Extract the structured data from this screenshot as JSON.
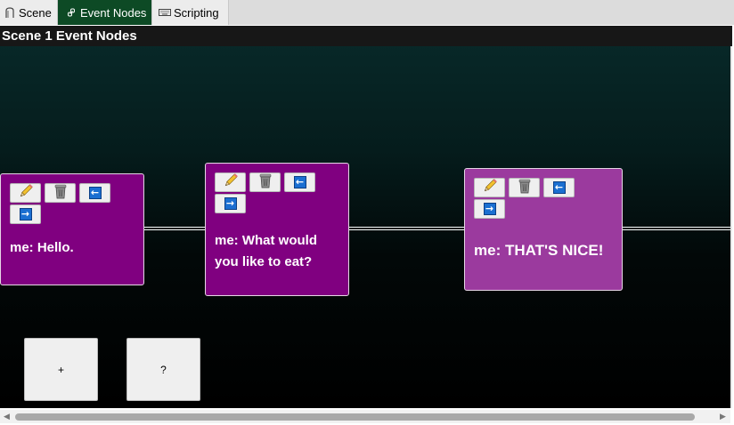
{
  "tabs": [
    {
      "label": "Scene",
      "icon": "scene-icon"
    },
    {
      "label": "Event Nodes",
      "icon": "link-icon"
    },
    {
      "label": "Scripting",
      "icon": "keyboard-icon"
    }
  ],
  "active_tab": "Event Nodes",
  "editor": {
    "title": "Scene 1 Event Nodes"
  },
  "nodes": [
    {
      "text": "me: Hello.",
      "buttons": [
        "pencil-icon",
        "trash-icon",
        "arrow-left-icon",
        "arrow-right-icon"
      ],
      "selected": false
    },
    {
      "text": "me: What would you like to eat?",
      "buttons": [
        "pencil-icon",
        "trash-icon",
        "arrow-left-icon",
        "arrow-right-icon"
      ],
      "selected": false
    },
    {
      "text": "me: THAT'S NICE!",
      "buttons": [
        "pencil-icon",
        "trash-icon",
        "arrow-left-icon",
        "arrow-right-icon"
      ],
      "selected": true
    }
  ],
  "actions": {
    "add_label": "+",
    "help_label": "?"
  },
  "colors": {
    "node": "#800080",
    "node_selected": "#9b3a9e",
    "active_tab": "#0d4a25",
    "header": "#171717"
  }
}
